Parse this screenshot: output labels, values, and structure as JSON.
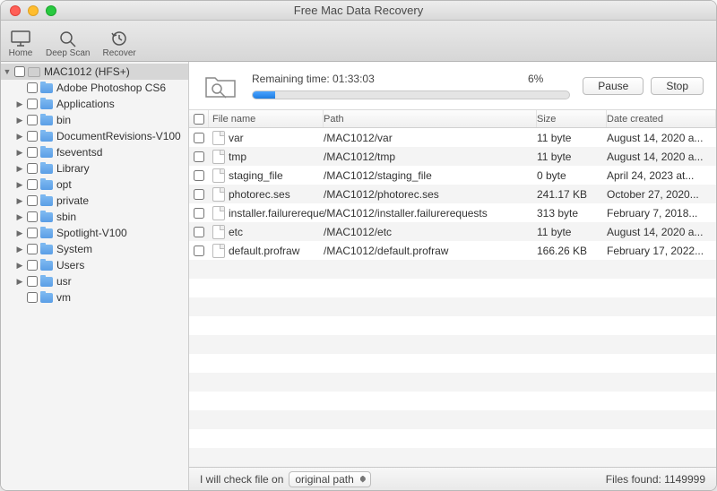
{
  "window": {
    "title": "Free Mac Data Recovery"
  },
  "toolbar": {
    "home": "Home",
    "deepscan": "Deep Scan",
    "recover": "Recover"
  },
  "sidebar": {
    "root": {
      "label": "MAC1012 (HFS+)"
    },
    "items": [
      {
        "label": "Adobe Photoshop CS6",
        "arrow": false
      },
      {
        "label": "Applications",
        "arrow": true
      },
      {
        "label": "bin",
        "arrow": true
      },
      {
        "label": "DocumentRevisions-V100",
        "arrow": true
      },
      {
        "label": "fseventsd",
        "arrow": true
      },
      {
        "label": "Library",
        "arrow": true
      },
      {
        "label": "opt",
        "arrow": true
      },
      {
        "label": "private",
        "arrow": true
      },
      {
        "label": "sbin",
        "arrow": true
      },
      {
        "label": "Spotlight-V100",
        "arrow": true
      },
      {
        "label": "System",
        "arrow": true
      },
      {
        "label": "Users",
        "arrow": true
      },
      {
        "label": "usr",
        "arrow": true
      },
      {
        "label": "vm",
        "arrow": false
      }
    ]
  },
  "scan": {
    "remaining_label": "Remaining time: 01:33:03",
    "percent": "6%",
    "progress_pct": 7,
    "pause": "Pause",
    "stop": "Stop"
  },
  "table": {
    "headers": {
      "name": "File name",
      "path": "Path",
      "size": "Size",
      "date": "Date created"
    },
    "rows": [
      {
        "name": "var",
        "path": "/MAC1012/var",
        "size": "11 byte",
        "date": "August 14, 2020 a..."
      },
      {
        "name": "tmp",
        "path": "/MAC1012/tmp",
        "size": "11 byte",
        "date": "August 14, 2020 a..."
      },
      {
        "name": "staging_file",
        "path": "/MAC1012/staging_file",
        "size": "0 byte",
        "date": "April 24, 2023 at..."
      },
      {
        "name": "photorec.ses",
        "path": "/MAC1012/photorec.ses",
        "size": "241.17 KB",
        "date": "October 27, 2020..."
      },
      {
        "name": "installer.failurerequests",
        "path": "/MAC1012/installer.failurerequests",
        "size": "313 byte",
        "date": "February 7, 2018..."
      },
      {
        "name": "etc",
        "path": "/MAC1012/etc",
        "size": "11 byte",
        "date": "August 14, 2020 a..."
      },
      {
        "name": "default.profraw",
        "path": "/MAC1012/default.profraw",
        "size": "166.26 KB",
        "date": "February 17, 2022..."
      }
    ]
  },
  "status": {
    "check_label": "I will check file on",
    "select_value": "original path",
    "found_label": "Files found: 1149999"
  }
}
